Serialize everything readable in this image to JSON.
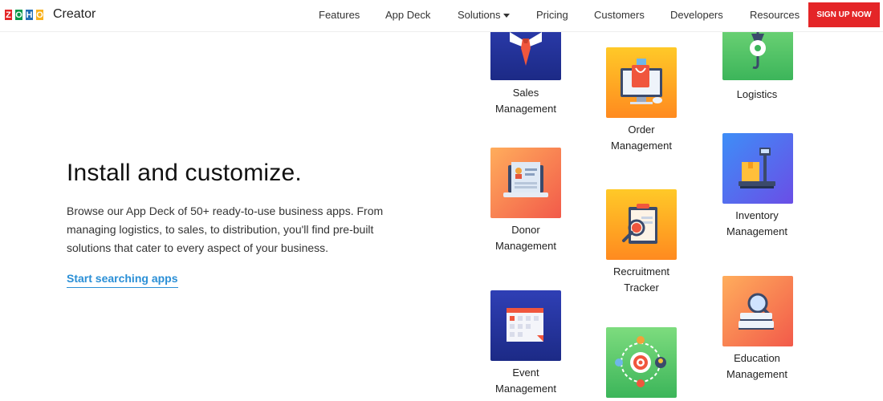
{
  "header": {
    "logo_letters": [
      "Z",
      "O",
      "H",
      "O"
    ],
    "product_name": "Creator",
    "nav": [
      {
        "label": "Features"
      },
      {
        "label": "App Deck"
      },
      {
        "label": "Solutions"
      },
      {
        "label": "Pricing"
      },
      {
        "label": "Customers"
      },
      {
        "label": "Developers"
      },
      {
        "label": "Resources"
      }
    ],
    "signup_label": "SIGN UP NOW"
  },
  "hero": {
    "title": "Install and customize.",
    "description": "Browse our App Deck of 50+ ready-to-use business apps. From managing logistics, to sales, to distribution, you'll find pre-built solutions that cater to every aspect of your business.",
    "link_label": "Start searching apps"
  },
  "apps": [
    {
      "line1": "Sales",
      "line2": "Management",
      "icon": "salesperson-tie-icon"
    },
    {
      "line1": "Order",
      "line2": "Management",
      "icon": "shopping-bag-monitor-icon"
    },
    {
      "line1": "Logistics",
      "line2": "",
      "icon": "crane-hook-icon"
    },
    {
      "line1": "Donor",
      "line2": "Management",
      "icon": "laptop-profile-icon"
    },
    {
      "line1": "Recruitment",
      "line2": "Tracker",
      "icon": "clipboard-search-icon"
    },
    {
      "line1": "Inventory",
      "line2": "Management",
      "icon": "weighing-scale-box-icon"
    },
    {
      "line1": "Event",
      "line2": "Management",
      "icon": "calendar-icon"
    },
    {
      "line1": "",
      "line2": "",
      "icon": "target-people-icon"
    },
    {
      "line1": "Education",
      "line2": "Management",
      "icon": "books-magnifier-icon"
    }
  ],
  "colors": {
    "brand_red": "#e42527",
    "link_blue": "#2a8fd6"
  }
}
